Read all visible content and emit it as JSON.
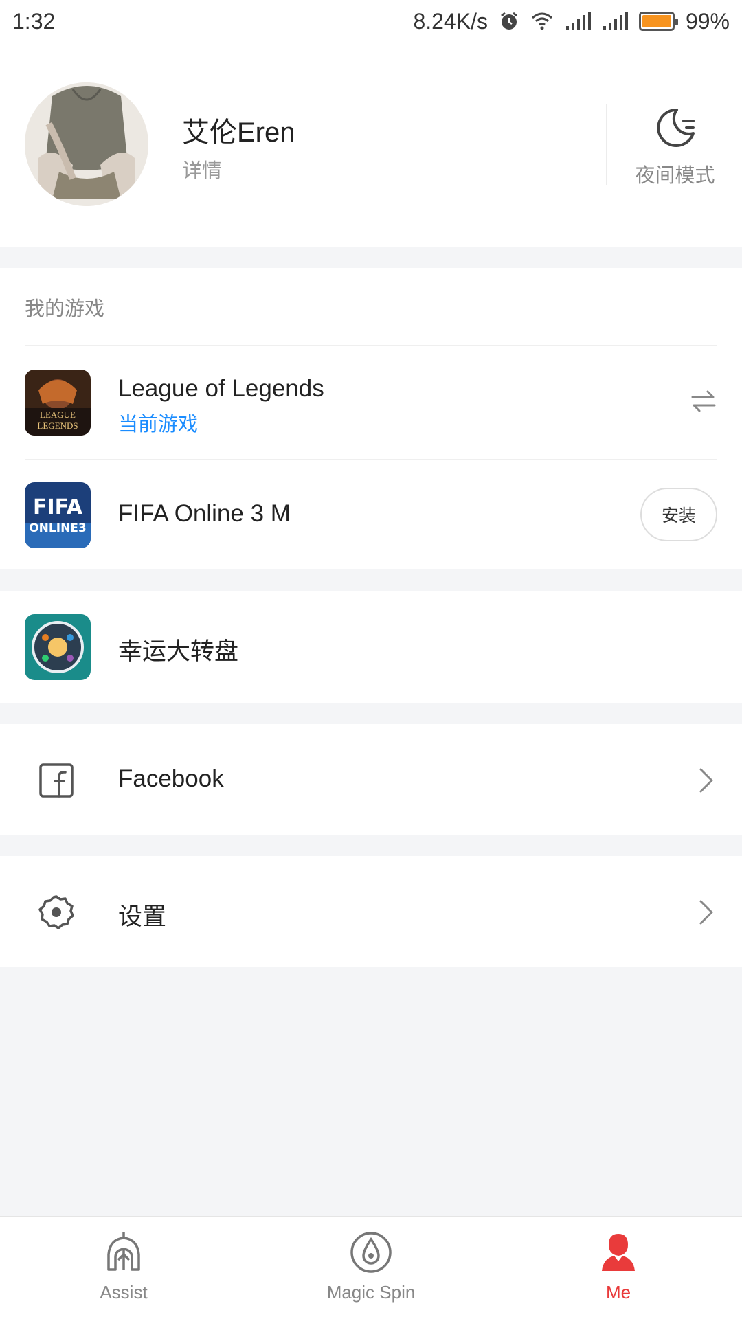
{
  "status_bar": {
    "time": "1:32",
    "speed": "8.24K/s",
    "battery": "99%",
    "battery_level": 0.99
  },
  "profile": {
    "name": "艾伦Eren",
    "detail": "详情",
    "night_mode_label": "夜间模式"
  },
  "my_games": {
    "title": "我的游戏",
    "items": [
      {
        "name": "League of Legends",
        "subtitle": "当前游戏",
        "action_icon": "switch-icon"
      },
      {
        "name": "FIFA Online 3 M",
        "action_label": "安装"
      }
    ]
  },
  "lucky_wheel": {
    "label": "幸运大转盘"
  },
  "menu": {
    "facebook": {
      "label": "Facebook",
      "icon": "facebook-icon"
    },
    "settings": {
      "label": "设置",
      "icon": "gear-icon"
    }
  },
  "bottom_nav": {
    "items": [
      {
        "label": "Assist",
        "icon": "helmet-icon"
      },
      {
        "label": "Magic Spin",
        "icon": "spin-icon"
      },
      {
        "label": "Me",
        "icon": "person-icon",
        "active": true
      }
    ]
  },
  "colors": {
    "accent_red": "#e93b3b",
    "link_blue": "#1a8cff",
    "battery_orange": "#f7931e",
    "background": "#f4f5f7"
  }
}
